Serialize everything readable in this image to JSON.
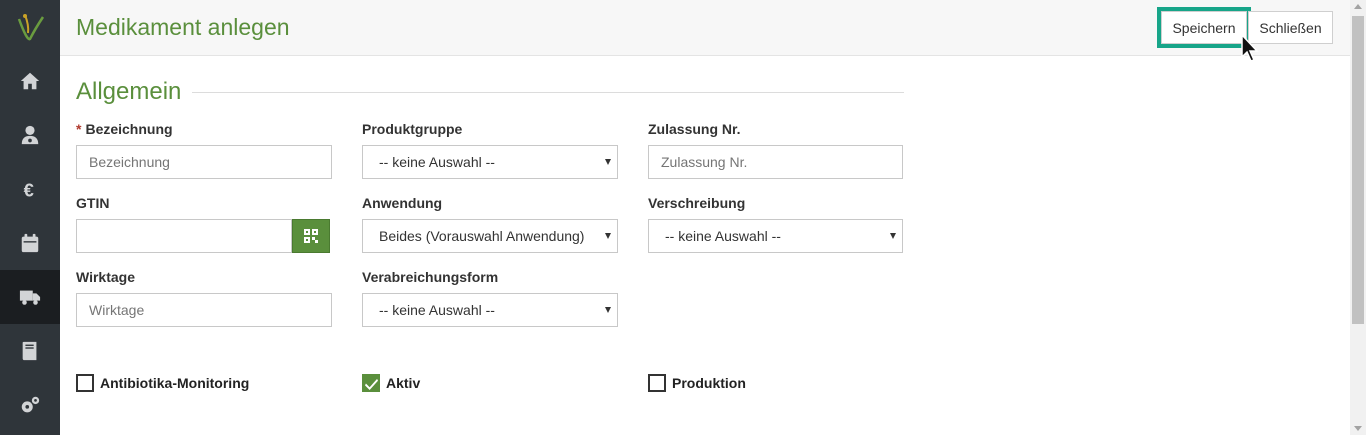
{
  "header": {
    "title": "Medikament anlegen",
    "save_label": "Speichern",
    "close_label": "Schließen"
  },
  "sidebar": {
    "items": [
      {
        "icon": "home-icon"
      },
      {
        "icon": "patient-icon"
      },
      {
        "icon": "euro-icon"
      },
      {
        "icon": "calendar-icon"
      },
      {
        "icon": "truck-icon",
        "active": true
      },
      {
        "icon": "book-icon"
      },
      {
        "icon": "gears-icon"
      }
    ]
  },
  "section": {
    "title": "Allgemein"
  },
  "form": {
    "bezeichnung": {
      "label": "Bezeichnung",
      "required_mark": "*",
      "value": "",
      "placeholder": "Bezeichnung"
    },
    "produktgruppe": {
      "label": "Produktgruppe",
      "selected": "-- keine Auswahl --"
    },
    "zulassung": {
      "label": "Zulassung Nr.",
      "value": "",
      "placeholder": "Zulassung Nr."
    },
    "gtin": {
      "label": "GTIN",
      "value": "",
      "placeholder": ""
    },
    "anwendung": {
      "label": "Anwendung",
      "selected": "Beides (Vorauswahl Anwendung)"
    },
    "verschreibung": {
      "label": "Verschreibung",
      "selected": "-- keine Auswahl --"
    },
    "wirktage": {
      "label": "Wirktage",
      "value": "",
      "placeholder": "Wirktage"
    },
    "verabreichungsform": {
      "label": "Verabreichungsform",
      "selected": "-- keine Auswahl --"
    }
  },
  "checkboxes": {
    "antibiotika": {
      "label": "Antibiotika-Monitoring",
      "checked": false
    },
    "aktiv": {
      "label": "Aktiv",
      "checked": true
    },
    "produktion": {
      "label": "Produktion",
      "checked": false
    }
  },
  "colors": {
    "accent": "#5a8f3c",
    "sidebar": "#2f353a",
    "highlight": "#17a589"
  }
}
